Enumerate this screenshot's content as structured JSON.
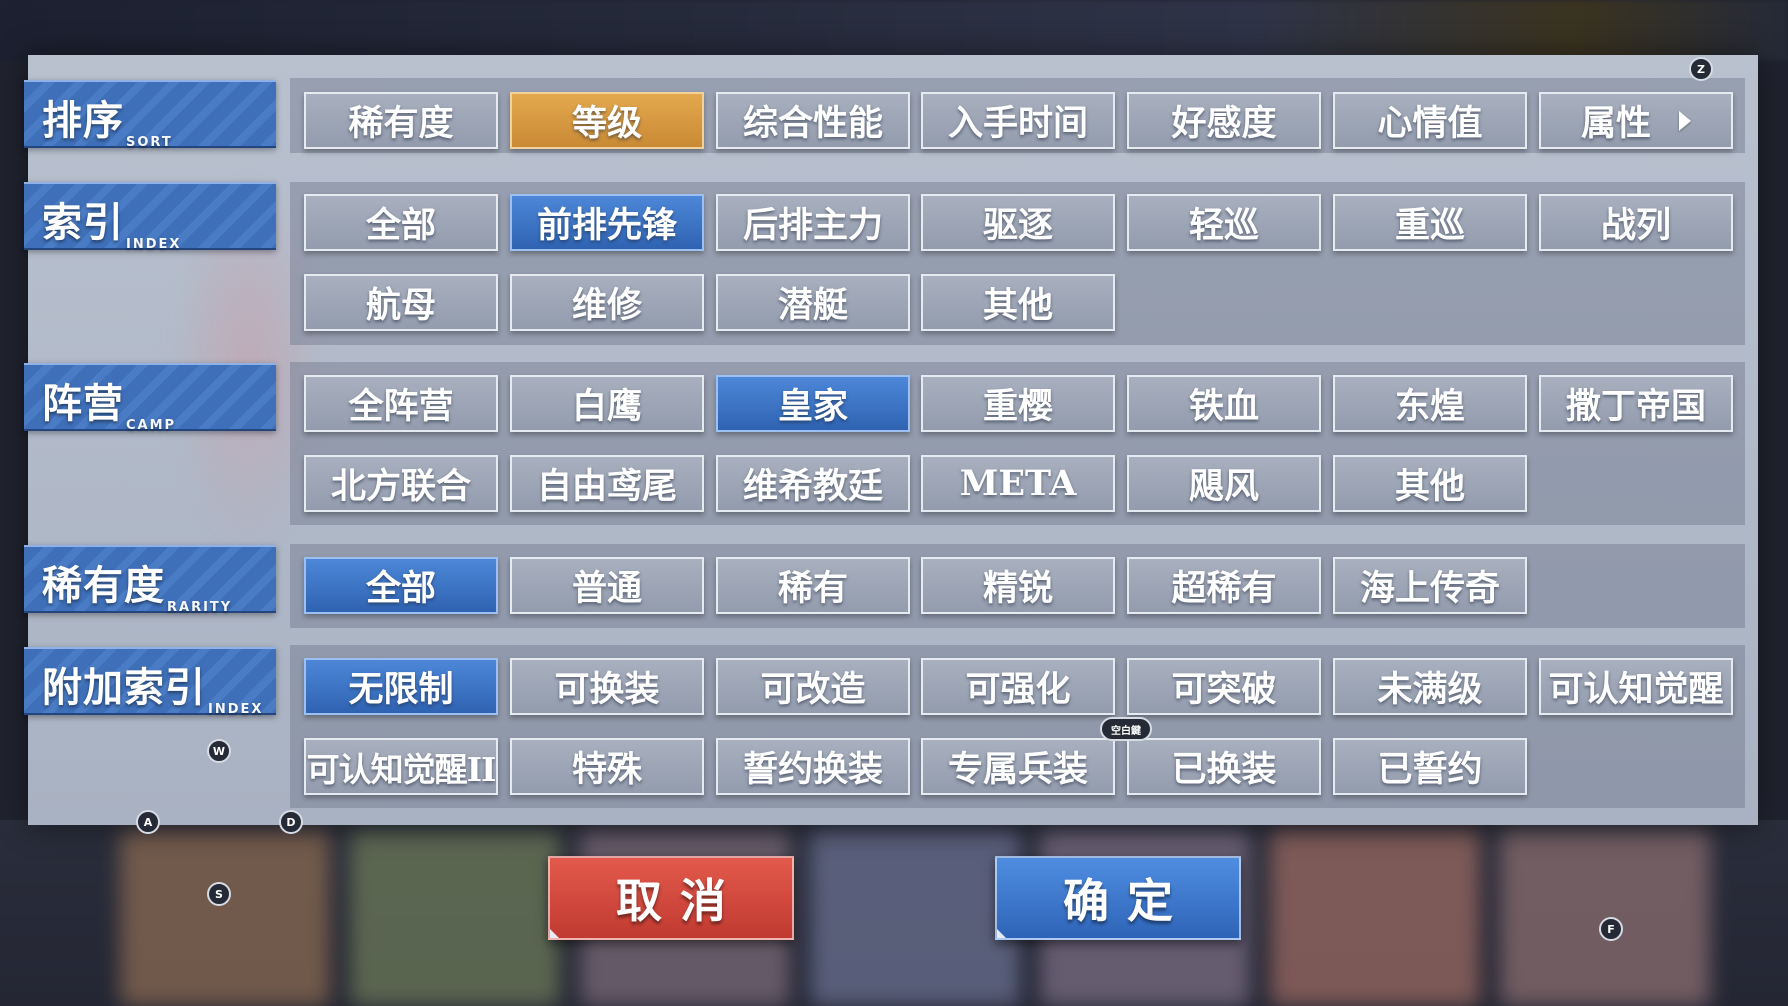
{
  "sections": {
    "sort": {
      "label": "排序",
      "label_en": "SORT",
      "options": [
        "稀有度",
        "等级",
        "综合性能",
        "入手时间",
        "好感度",
        "心情值",
        "属性"
      ],
      "selected": "等级"
    },
    "index": {
      "label": "索引",
      "label_en": "INDEX",
      "options": [
        "全部",
        "前排先锋",
        "后排主力",
        "驱逐",
        "轻巡",
        "重巡",
        "战列",
        "航母",
        "维修",
        "潜艇",
        "其他"
      ],
      "selected": "前排先锋"
    },
    "camp": {
      "label": "阵营",
      "label_en": "CAMP",
      "options": [
        "全阵营",
        "白鹰",
        "皇家",
        "重樱",
        "铁血",
        "东煌",
        "撒丁帝国",
        "北方联合",
        "自由鸢尾",
        "维希教廷",
        "META",
        "飓风",
        "其他"
      ],
      "selected": "皇家"
    },
    "rarity": {
      "label": "稀有度",
      "label_en": "RARITY",
      "options": [
        "全部",
        "普通",
        "稀有",
        "精锐",
        "超稀有",
        "海上传奇"
      ],
      "selected": "全部"
    },
    "extra": {
      "label": "附加索引",
      "label_en": "INDEX",
      "options": [
        "无限制",
        "可换装",
        "可改造",
        "可强化",
        "可突破",
        "未满级",
        "可认知觉醒",
        "可认知觉醒II",
        "特殊",
        "誓约换装",
        "专属兵装",
        "已换装",
        "已誓约"
      ],
      "selected": "无限制"
    }
  },
  "buttons": {
    "cancel": "取消",
    "confirm": "确定"
  },
  "key_hints": {
    "z": "Z",
    "w": "W",
    "a": "A",
    "d": "D",
    "s": "S",
    "f": "F",
    "space": "空白鍵"
  },
  "colors": {
    "selected_orange": "#d6973f",
    "selected_blue": "#3f76c8",
    "cancel_red": "#d1473d",
    "confirm_blue": "#3c78cc"
  },
  "icons": [
    "chevron-right-icon"
  ]
}
